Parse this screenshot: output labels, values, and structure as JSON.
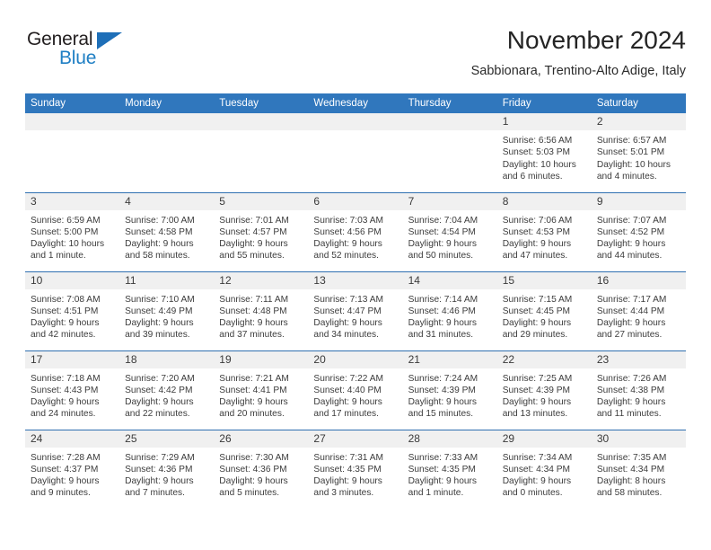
{
  "brand": {
    "name_part1": "General",
    "name_part2": "Blue",
    "triangle_icon": "triangle-icon",
    "accent_color": "#1e6fb8"
  },
  "header": {
    "title": "November 2024",
    "subtitle": "Sabbionara, Trentino-Alto Adige, Italy"
  },
  "calendar": {
    "header_color": "#3077bd",
    "daynum_band_color": "#f0f0f0",
    "weekday_headers": [
      "Sunday",
      "Monday",
      "Tuesday",
      "Wednesday",
      "Thursday",
      "Friday",
      "Saturday"
    ],
    "weeks": [
      [
        {
          "day": "",
          "lines": []
        },
        {
          "day": "",
          "lines": []
        },
        {
          "day": "",
          "lines": []
        },
        {
          "day": "",
          "lines": []
        },
        {
          "day": "",
          "lines": []
        },
        {
          "day": "1",
          "lines": [
            "Sunrise: 6:56 AM",
            "Sunset: 5:03 PM",
            "Daylight: 10 hours",
            "and 6 minutes."
          ]
        },
        {
          "day": "2",
          "lines": [
            "Sunrise: 6:57 AM",
            "Sunset: 5:01 PM",
            "Daylight: 10 hours",
            "and 4 minutes."
          ]
        }
      ],
      [
        {
          "day": "3",
          "lines": [
            "Sunrise: 6:59 AM",
            "Sunset: 5:00 PM",
            "Daylight: 10 hours",
            "and 1 minute."
          ]
        },
        {
          "day": "4",
          "lines": [
            "Sunrise: 7:00 AM",
            "Sunset: 4:58 PM",
            "Daylight: 9 hours",
            "and 58 minutes."
          ]
        },
        {
          "day": "5",
          "lines": [
            "Sunrise: 7:01 AM",
            "Sunset: 4:57 PM",
            "Daylight: 9 hours",
            "and 55 minutes."
          ]
        },
        {
          "day": "6",
          "lines": [
            "Sunrise: 7:03 AM",
            "Sunset: 4:56 PM",
            "Daylight: 9 hours",
            "and 52 minutes."
          ]
        },
        {
          "day": "7",
          "lines": [
            "Sunrise: 7:04 AM",
            "Sunset: 4:54 PM",
            "Daylight: 9 hours",
            "and 50 minutes."
          ]
        },
        {
          "day": "8",
          "lines": [
            "Sunrise: 7:06 AM",
            "Sunset: 4:53 PM",
            "Daylight: 9 hours",
            "and 47 minutes."
          ]
        },
        {
          "day": "9",
          "lines": [
            "Sunrise: 7:07 AM",
            "Sunset: 4:52 PM",
            "Daylight: 9 hours",
            "and 44 minutes."
          ]
        }
      ],
      [
        {
          "day": "10",
          "lines": [
            "Sunrise: 7:08 AM",
            "Sunset: 4:51 PM",
            "Daylight: 9 hours",
            "and 42 minutes."
          ]
        },
        {
          "day": "11",
          "lines": [
            "Sunrise: 7:10 AM",
            "Sunset: 4:49 PM",
            "Daylight: 9 hours",
            "and 39 minutes."
          ]
        },
        {
          "day": "12",
          "lines": [
            "Sunrise: 7:11 AM",
            "Sunset: 4:48 PM",
            "Daylight: 9 hours",
            "and 37 minutes."
          ]
        },
        {
          "day": "13",
          "lines": [
            "Sunrise: 7:13 AM",
            "Sunset: 4:47 PM",
            "Daylight: 9 hours",
            "and 34 minutes."
          ]
        },
        {
          "day": "14",
          "lines": [
            "Sunrise: 7:14 AM",
            "Sunset: 4:46 PM",
            "Daylight: 9 hours",
            "and 31 minutes."
          ]
        },
        {
          "day": "15",
          "lines": [
            "Sunrise: 7:15 AM",
            "Sunset: 4:45 PM",
            "Daylight: 9 hours",
            "and 29 minutes."
          ]
        },
        {
          "day": "16",
          "lines": [
            "Sunrise: 7:17 AM",
            "Sunset: 4:44 PM",
            "Daylight: 9 hours",
            "and 27 minutes."
          ]
        }
      ],
      [
        {
          "day": "17",
          "lines": [
            "Sunrise: 7:18 AM",
            "Sunset: 4:43 PM",
            "Daylight: 9 hours",
            "and 24 minutes."
          ]
        },
        {
          "day": "18",
          "lines": [
            "Sunrise: 7:20 AM",
            "Sunset: 4:42 PM",
            "Daylight: 9 hours",
            "and 22 minutes."
          ]
        },
        {
          "day": "19",
          "lines": [
            "Sunrise: 7:21 AM",
            "Sunset: 4:41 PM",
            "Daylight: 9 hours",
            "and 20 minutes."
          ]
        },
        {
          "day": "20",
          "lines": [
            "Sunrise: 7:22 AM",
            "Sunset: 4:40 PM",
            "Daylight: 9 hours",
            "and 17 minutes."
          ]
        },
        {
          "day": "21",
          "lines": [
            "Sunrise: 7:24 AM",
            "Sunset: 4:39 PM",
            "Daylight: 9 hours",
            "and 15 minutes."
          ]
        },
        {
          "day": "22",
          "lines": [
            "Sunrise: 7:25 AM",
            "Sunset: 4:39 PM",
            "Daylight: 9 hours",
            "and 13 minutes."
          ]
        },
        {
          "day": "23",
          "lines": [
            "Sunrise: 7:26 AM",
            "Sunset: 4:38 PM",
            "Daylight: 9 hours",
            "and 11 minutes."
          ]
        }
      ],
      [
        {
          "day": "24",
          "lines": [
            "Sunrise: 7:28 AM",
            "Sunset: 4:37 PM",
            "Daylight: 9 hours",
            "and 9 minutes."
          ]
        },
        {
          "day": "25",
          "lines": [
            "Sunrise: 7:29 AM",
            "Sunset: 4:36 PM",
            "Daylight: 9 hours",
            "and 7 minutes."
          ]
        },
        {
          "day": "26",
          "lines": [
            "Sunrise: 7:30 AM",
            "Sunset: 4:36 PM",
            "Daylight: 9 hours",
            "and 5 minutes."
          ]
        },
        {
          "day": "27",
          "lines": [
            "Sunrise: 7:31 AM",
            "Sunset: 4:35 PM",
            "Daylight: 9 hours",
            "and 3 minutes."
          ]
        },
        {
          "day": "28",
          "lines": [
            "Sunrise: 7:33 AM",
            "Sunset: 4:35 PM",
            "Daylight: 9 hours",
            "and 1 minute."
          ]
        },
        {
          "day": "29",
          "lines": [
            "Sunrise: 7:34 AM",
            "Sunset: 4:34 PM",
            "Daylight: 9 hours",
            "and 0 minutes."
          ]
        },
        {
          "day": "30",
          "lines": [
            "Sunrise: 7:35 AM",
            "Sunset: 4:34 PM",
            "Daylight: 8 hours",
            "and 58 minutes."
          ]
        }
      ]
    ]
  }
}
